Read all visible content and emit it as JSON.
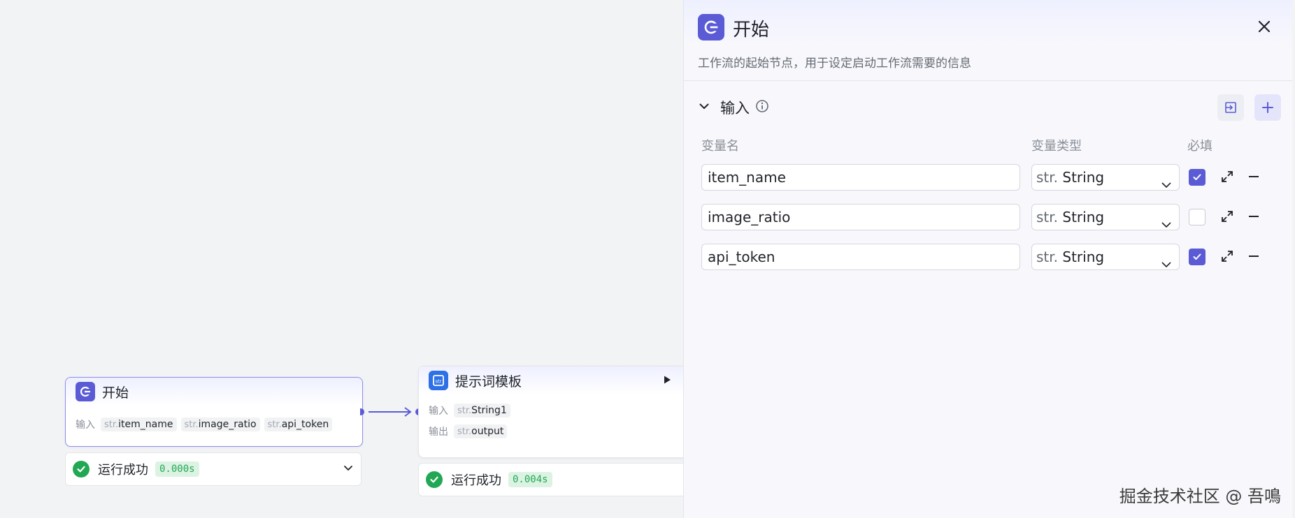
{
  "canvas": {
    "start_node": {
      "title": "开始",
      "input_label": "输入",
      "inputs": [
        {
          "type": "str.",
          "name": "item_name"
        },
        {
          "type": "str.",
          "name": "image_ratio"
        },
        {
          "type": "str.",
          "name": "api_token"
        }
      ],
      "status": {
        "text": "运行成功",
        "duration": "0.000s"
      }
    },
    "prompt_node": {
      "title": "提示词模板",
      "input_label": "输入",
      "output_label": "输出",
      "input": {
        "type": "str.",
        "name": "String1"
      },
      "output": {
        "type": "str.",
        "name": "output"
      },
      "status": {
        "text": "运行成功",
        "duration": "0.004s"
      }
    }
  },
  "panel": {
    "title": "开始",
    "description": "工作流的起始节点，用于设定启动工作流需要的信息",
    "section": {
      "title": "输入",
      "columns": {
        "name": "变量名",
        "type": "变量类型",
        "required": "必填"
      },
      "variables": [
        {
          "name": "item_name",
          "type_prefix": "str.",
          "type": "String",
          "required": true
        },
        {
          "name": "image_ratio",
          "type_prefix": "str.",
          "type": "String",
          "required": false
        },
        {
          "name": "api_token",
          "type_prefix": "str.",
          "type": "String",
          "required": true
        }
      ]
    }
  },
  "watermark": "掘金技术社区 @ 吾鳴",
  "colors": {
    "accent": "#5b5bd6",
    "success": "#22a854",
    "prompt_icon": "#2e70e6"
  }
}
